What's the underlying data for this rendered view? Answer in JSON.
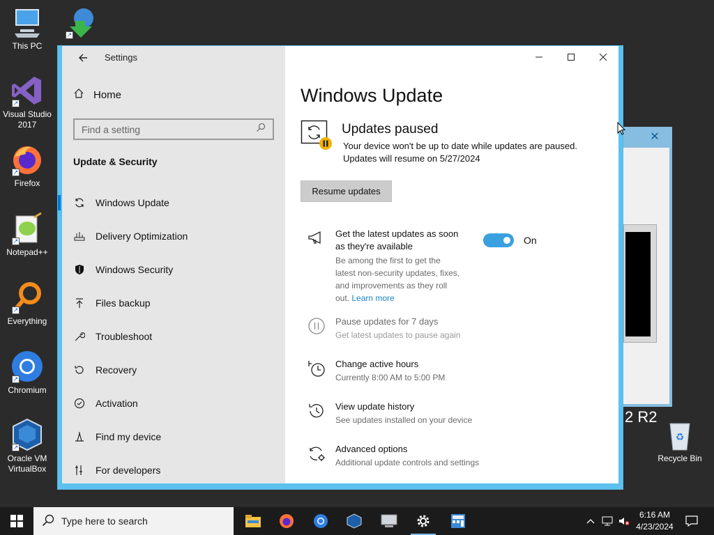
{
  "desktop": {
    "icons": [
      {
        "label": "This PC",
        "icon": "computer-icon"
      },
      {
        "label": "Visual Studio 2017",
        "icon": "visual-studio-icon"
      },
      {
        "label": "Firefox",
        "icon": "firefox-icon"
      },
      {
        "label": "Notepad++",
        "icon": "notepadpp-icon"
      },
      {
        "label": "Everything",
        "icon": "everything-search-icon"
      },
      {
        "label": "Chromium",
        "icon": "chromium-icon"
      },
      {
        "label": "Oracle VM VirtualBox",
        "icon": "virtualbox-icon"
      },
      {
        "label": "Recycle Bin",
        "icon": "recycle-bin-icon"
      }
    ],
    "background_text": "2 R2"
  },
  "settings_window": {
    "title": "Settings",
    "sidebar": {
      "home_label": "Home",
      "search_placeholder": "Find a setting",
      "section_heading": "Update & Security",
      "items": [
        {
          "label": "Windows Update",
          "icon": "sync-icon",
          "selected": true
        },
        {
          "label": "Delivery Optimization",
          "icon": "delivery-optimization-icon"
        },
        {
          "label": "Windows Security",
          "icon": "shield-icon"
        },
        {
          "label": "Files backup",
          "icon": "backup-arrow-icon"
        },
        {
          "label": "Troubleshoot",
          "icon": "wrench-icon"
        },
        {
          "label": "Recovery",
          "icon": "recovery-icon"
        },
        {
          "label": "Activation",
          "icon": "check-circle-icon"
        },
        {
          "label": "Find my device",
          "icon": "find-device-icon"
        },
        {
          "label": "For developers",
          "icon": "developer-tools-icon"
        }
      ]
    },
    "main": {
      "title": "Windows Update",
      "status_title": "Updates paused",
      "status_line1": "Your device won't be up to date while updates are paused.",
      "status_line2": "Updates will resume on 5/27/2024",
      "resume_button": "Resume updates",
      "options": [
        {
          "title_line1": "Get the latest updates as soon",
          "title_line2": "as they're available",
          "desc_line1": "Be among the first to get the",
          "desc_line2": "latest non-security updates, fixes,",
          "desc_line3": "and improvements as they roll",
          "desc_line4": "out.",
          "link": "Learn more",
          "toggle_state": "On",
          "toggle_on": true,
          "icon": "megaphone-icon"
        },
        {
          "title": "Pause updates for 7 days",
          "desc": "Get latest updates to pause again",
          "icon": "pause-icon",
          "disabled": true
        },
        {
          "title": "Change active hours",
          "desc": "Currently 8:00 AM to 5:00 PM",
          "icon": "active-hours-clock-icon"
        },
        {
          "title": "View update history",
          "desc": "See updates installed on your device",
          "icon": "history-icon"
        },
        {
          "title": "Advanced options",
          "desc": "Additional update controls and settings",
          "icon": "advanced-options-icon"
        }
      ]
    }
  },
  "taskbar": {
    "search_placeholder": "Type here to search",
    "apps": [
      "file-explorer-icon",
      "firefox-icon",
      "chromium-icon",
      "virtualbox-icon",
      "remote-desktop-icon",
      "settings-gear-icon",
      "calculator-icon"
    ],
    "clock_time": "6:16 AM",
    "clock_date": "4/23/2024"
  },
  "colors": {
    "accent": "#0078d7",
    "window_border": "#5cc1ee",
    "toggle_on": "#3aa0e0",
    "link": "#1a86c8",
    "pause_badge": "#f2b300"
  }
}
